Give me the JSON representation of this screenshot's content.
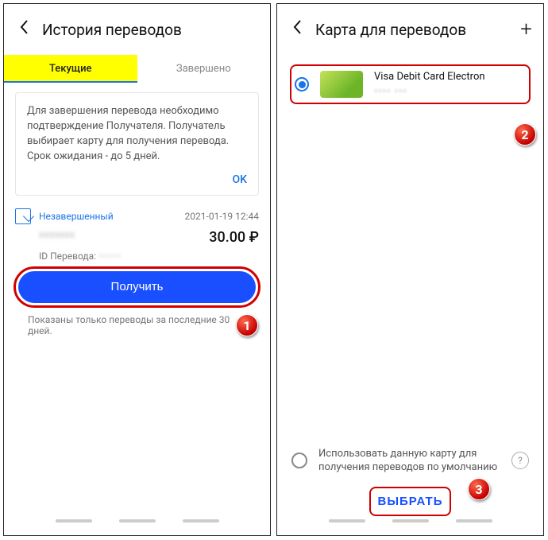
{
  "left": {
    "title": "История переводов",
    "tabs": {
      "active": "Текущие",
      "done": "Завершено"
    },
    "notice": "Для завершения перевода необходимо подтверждение Получателя. Получатель выбирает карту для получения перевода. Срок ожидания - до 5 дней.",
    "ok": "OK",
    "item": {
      "status": "Незавершенный",
      "date": "2021-01-19 12:44",
      "amount": "30.00 ₽",
      "idlabel": "ID Перевода:",
      "idvalue": "•••••••"
    },
    "receive_btn": "Получить",
    "footnote": "Показаны только переводы за последние 30 дней."
  },
  "right": {
    "title": "Карта для переводов",
    "card": {
      "name": "Visa Debit Card Electron",
      "mask": "•••• •••"
    },
    "default_opt": "Использовать данную карту для получения переводов по умолчанию",
    "help": "?",
    "select_btn": "ВЫБРАТЬ"
  },
  "badges": {
    "b1": "1",
    "b2": "2",
    "b3": "3"
  }
}
